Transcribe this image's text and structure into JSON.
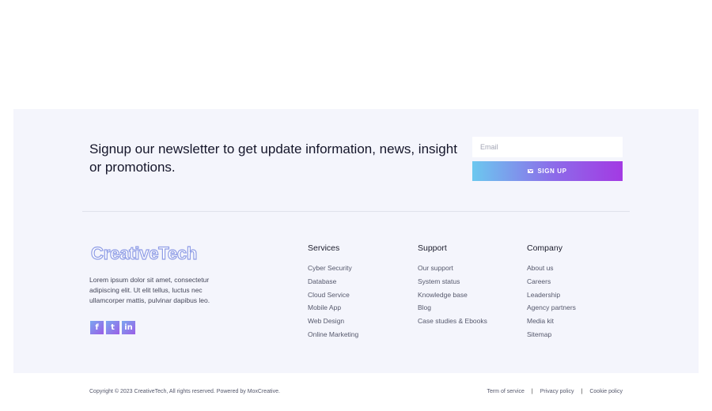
{
  "newsletter": {
    "heading": "Signup our newsletter to get update information, news, insight or promotions.",
    "email_placeholder": "Email",
    "signup_label": "SIGN UP"
  },
  "brand": {
    "logo_text": "CreativeTech",
    "description": "Lorem ipsum dolor sit amet, consectetur adipiscing elit. Ut elit tellus, luctus nec ullamcorper mattis, pulvinar dapibus leo.",
    "social": [
      {
        "icon": "facebook-icon",
        "glyph": "f"
      },
      {
        "icon": "twitter-icon",
        "glyph": "t"
      },
      {
        "icon": "linkedin-icon",
        "glyph": "in"
      }
    ]
  },
  "columns": {
    "services": {
      "title": "Services",
      "items": [
        "Cyber Security",
        "Database",
        "Cloud Service",
        "Mobile App",
        "Web Design",
        "Online Marketing"
      ]
    },
    "support": {
      "title": "Support",
      "items": [
        "Our support",
        "System status",
        "Knowledge base",
        "Blog",
        "Case studies & Ebooks"
      ]
    },
    "company": {
      "title": "Company",
      "items": [
        "About us",
        "Careers",
        "Leadership",
        "Agency partners",
        "Media kit",
        "Sitemap"
      ]
    }
  },
  "bottom_bar": {
    "copyright": "Copyright © 2023 CreativeTech, All rights reserved. Powered by MoxCreative.",
    "links": [
      "Term of service",
      "Privacy policy",
      "Cookie policy"
    ],
    "separator": "|"
  },
  "colors": {
    "panel_background": "#f4f5fc",
    "gradient_start": "#6cc8ef",
    "gradient_end": "#a33ae3"
  }
}
